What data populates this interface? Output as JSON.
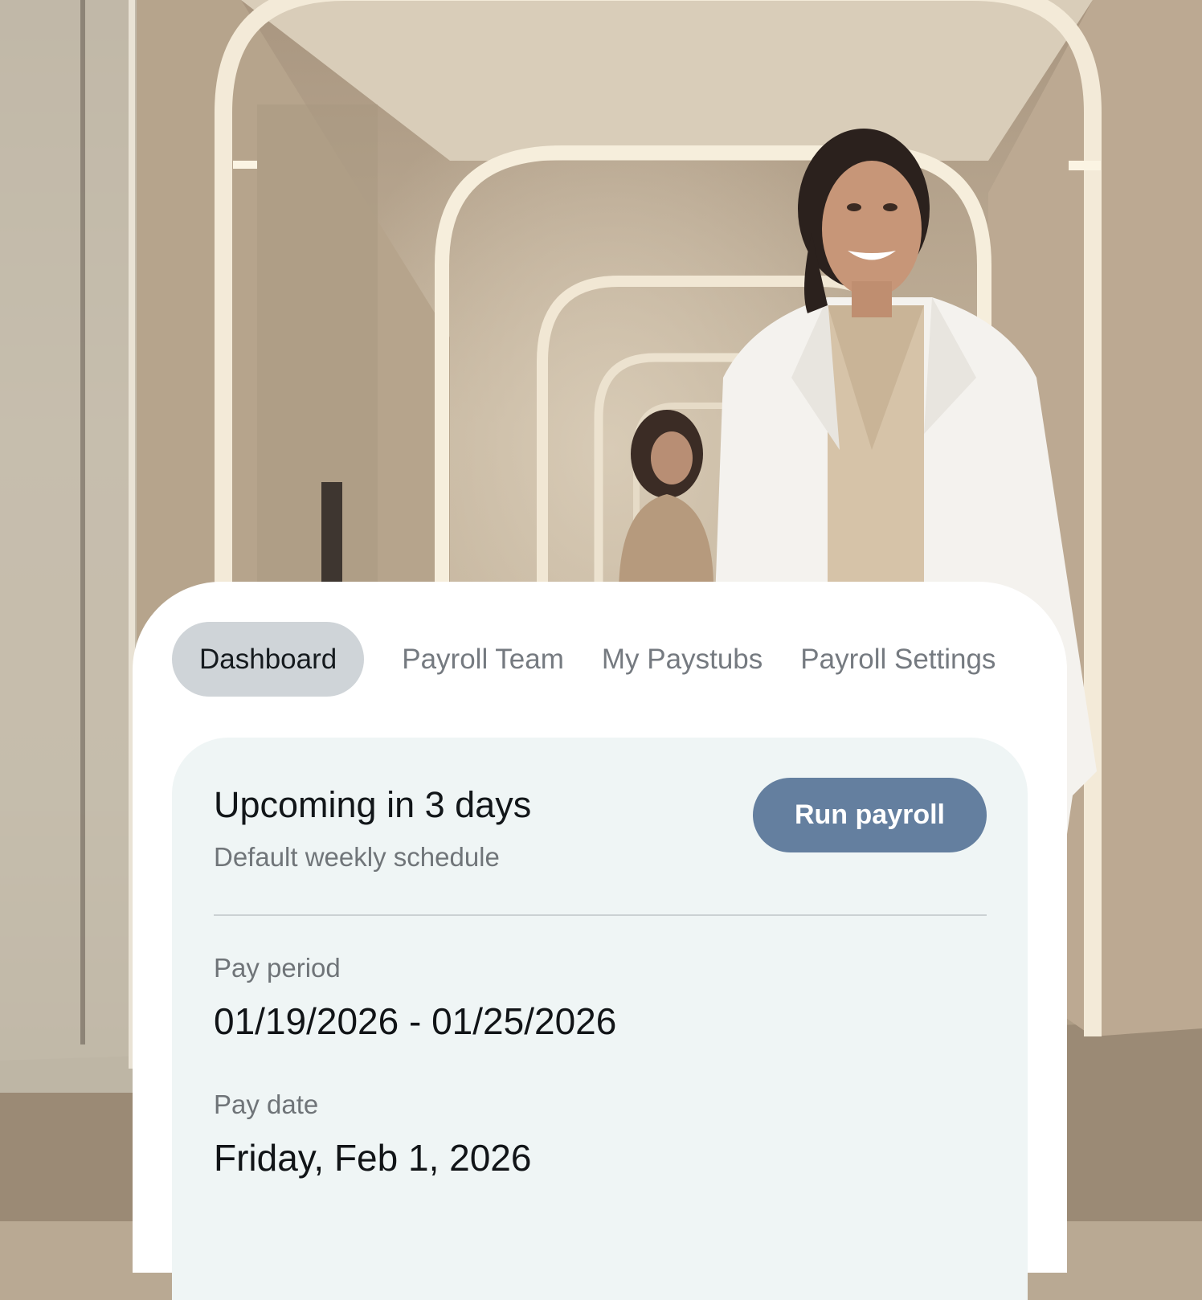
{
  "tabs": [
    {
      "label": "Dashboard",
      "active": true
    },
    {
      "label": "Payroll Team",
      "active": false
    },
    {
      "label": "My Paystubs",
      "active": false
    },
    {
      "label": "Payroll Settings",
      "active": false
    }
  ],
  "upcoming": {
    "title": "Upcoming in 3 days",
    "schedule": "Default weekly schedule",
    "button_label": "Run payroll"
  },
  "pay_period": {
    "label": "Pay period",
    "value": "01/19/2026 - 01/25/2026"
  },
  "pay_date": {
    "label": "Pay date",
    "value": "Friday, Feb 1, 2026"
  },
  "colors": {
    "active_tab": "#cfd4d8",
    "button": "#647f9f",
    "info_panel": "#eff5f5"
  }
}
